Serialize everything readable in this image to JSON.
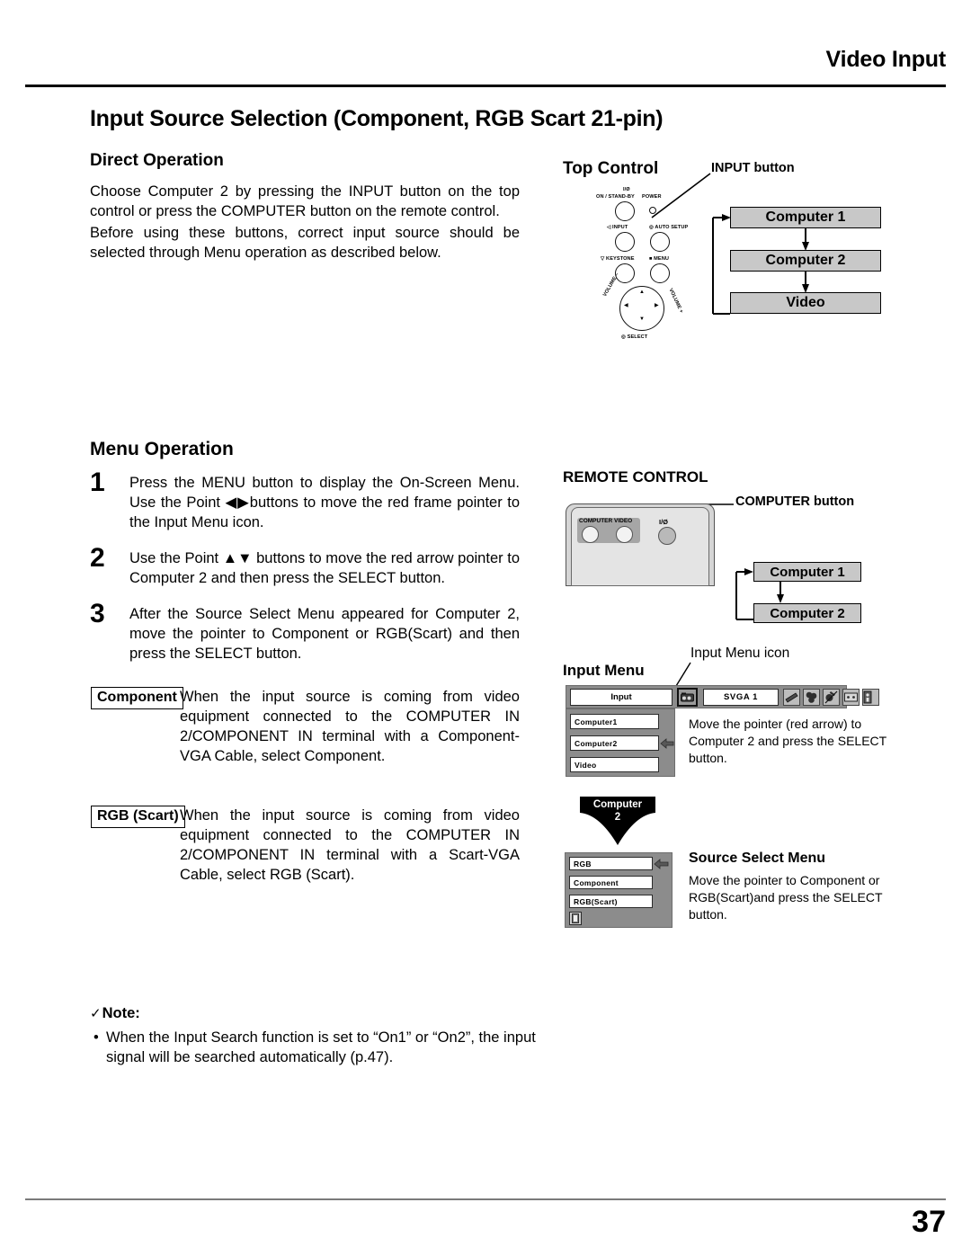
{
  "header": {
    "title": "Video Input"
  },
  "section": {
    "title": "Input Source Selection (Component, RGB Scart 21-pin)"
  },
  "direct_operation": {
    "heading": "Direct Operation",
    "paragraph1": "Choose Computer 2 by pressing the INPUT button on the top control or press the COMPUTER button on the remote control.",
    "paragraph2": "Before using these buttons, correct input source should be selected through Menu operation as described below."
  },
  "menu_operation": {
    "heading": "Menu Operation",
    "steps": [
      {
        "num": "1",
        "text": "Press the MENU button to display the On-Screen Menu. Use the Point ◀▶buttons to move the red frame pointer to the Input Menu icon."
      },
      {
        "num": "2",
        "text": "Use the Point ▲▼ buttons to move the red arrow pointer to Computer 2 and then press the SELECT button."
      },
      {
        "num": "3",
        "text": "After the Source Select Menu appeared for Computer 2, move the pointer to Component or RGB(Scart) and then press the SELECT button."
      }
    ]
  },
  "definitions": [
    {
      "label": "Component",
      "text": "When the input source is coming from video equipment connected to the COMPUTER IN 2/COMPONENT IN terminal with a Component-VGA Cable, select Component."
    },
    {
      "label": "RGB (Scart)",
      "text": "When the input source is coming from video equipment connected to the COMPUTER IN 2/COMPONENT IN terminal with a Scart-VGA Cable, select RGB (Scart)."
    }
  ],
  "note": {
    "check": "✓",
    "heading": "Note:",
    "items": [
      "When the Input Search function is set to “On1” or “On2”, the input signal will be searched automatically (p.47)."
    ]
  },
  "top_control": {
    "heading": "Top Control",
    "callout": "INPUT button",
    "panel_labels": {
      "power_symbol": "I/Ø",
      "on_standby": "ON / STAND-BY",
      "power": "POWER",
      "input": "INPUT",
      "auto_setup": "AUTO SETUP",
      "keystone": "KEYSTONE",
      "menu": "MENU",
      "volume_minus": "VOLUME –",
      "volume_plus": "VOLUME +",
      "select": "SELECT"
    },
    "flow": [
      "Computer 1",
      "Computer 2",
      "Video"
    ]
  },
  "remote_control": {
    "heading": "REMOTE CONTROL",
    "callout": "COMPUTER button",
    "buttons": {
      "computer": "COMPUTER",
      "video": "VIDEO",
      "power": "I/Ø"
    },
    "flow": [
      "Computer 1",
      "Computer 2"
    ]
  },
  "input_menu": {
    "heading": "Input Menu",
    "icon_callout": "Input Menu icon",
    "bar": {
      "title": "Input",
      "mode": "SVGA 1"
    },
    "icon_names": [
      "input-menu-icon",
      "screen-icon",
      "color-adjust-icon",
      "image-adjust-icon",
      "setting-icon",
      "info-icon"
    ],
    "items": [
      "Computer1",
      "Computer2",
      "Video"
    ],
    "selected": "Computer2",
    "description": "Move the pointer (red arrow) to Computer 2 and press the SELECT button."
  },
  "computer2_arrow": {
    "line1": "Computer",
    "line2": "2"
  },
  "source_select_menu": {
    "heading": "Source Select Menu",
    "items": [
      "RGB",
      "Component",
      "RGB(Scart)"
    ],
    "selected": "RGB",
    "description": "Move the pointer to Component or RGB(Scart)and press the SELECT button."
  },
  "footer": {
    "page_number": "37"
  },
  "colors": {
    "flow_box_fill": "#c8c8c8",
    "osd_bg": "#8c8c8c",
    "remote_body": "#d5d5d5",
    "footer_rule": "#7a7a7a"
  }
}
